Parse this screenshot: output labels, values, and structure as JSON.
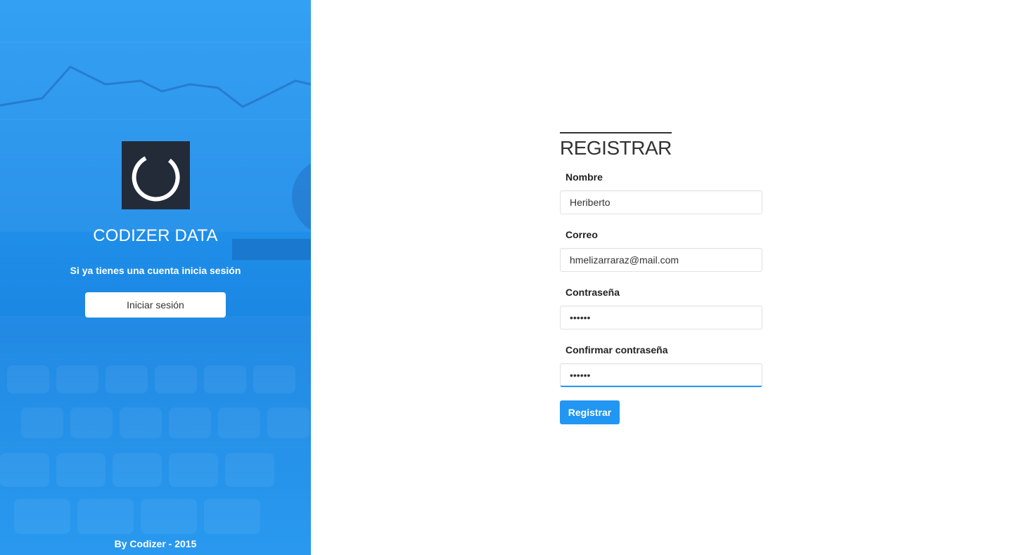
{
  "sidebar": {
    "brand": "CODIZER DATA",
    "tagline": "Si ya tienes una cuenta inicia sesión",
    "login_button": "Iniciar sesión",
    "footer": "By Codizer - 2015",
    "logo_icon": "circular-arc-logo-icon"
  },
  "form": {
    "title": "REGISTRAR",
    "fields": [
      {
        "label": "Nombre",
        "value": "Heriberto",
        "type": "text"
      },
      {
        "label": "Correo",
        "value": "hmelizarraraz@mail.com",
        "type": "email"
      },
      {
        "label": "Contraseña",
        "value": "••••••",
        "type": "password"
      },
      {
        "label": "Confirmar contraseña",
        "value": "••••••",
        "type": "password"
      }
    ],
    "submit": "Registrar"
  },
  "colors": {
    "accent": "#2196f3",
    "panel_blue": "#1e8de8",
    "logo_bg": "#232b38"
  }
}
